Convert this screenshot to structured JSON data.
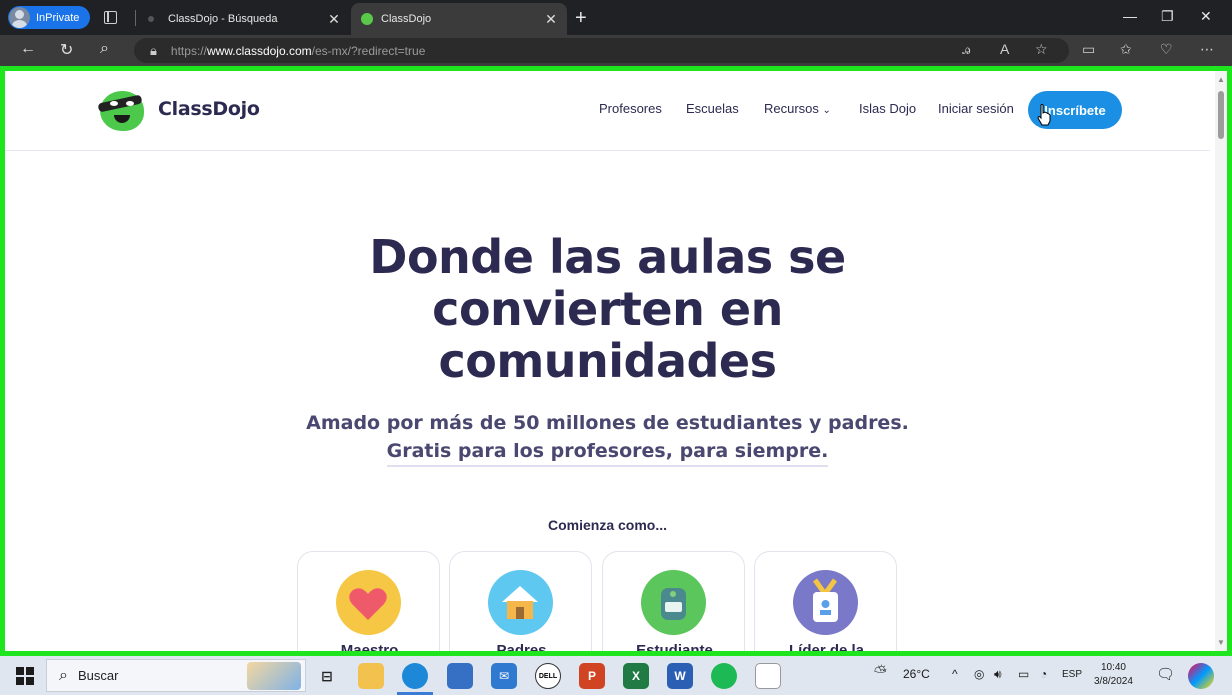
{
  "browser": {
    "inprivate_label": "InPrivate",
    "tabs": [
      {
        "title": "ClassDojo - Búsqueda"
      },
      {
        "title": "ClassDojo"
      }
    ],
    "url_scheme": "https://",
    "url_host": "www.classdojo.com",
    "url_path": "/es-mx/?redirect=true"
  },
  "site": {
    "brand": "ClassDojo",
    "nav": [
      {
        "label": "Profesores"
      },
      {
        "label": "Escuelas"
      },
      {
        "label": "Recursos"
      },
      {
        "label": "Islas Dojo"
      },
      {
        "label": "Iniciar sesión"
      }
    ],
    "signup_label": "Inscríbete",
    "hero_line1": "Donde las aulas se",
    "hero_line2": "convierten en",
    "hero_line3": "comunidades",
    "sub1": "Amado por más de 50 millones de estudiantes y padres.",
    "sub2": "Gratis para los profesores, para siempre.",
    "start_as": "Comienza como...",
    "roles": [
      {
        "label": "Maestro"
      },
      {
        "label": "Padres"
      },
      {
        "label": "Estudiante"
      },
      {
        "label": "Líder de la"
      }
    ]
  },
  "taskbar": {
    "search_placeholder": "Buscar",
    "weather": "26°C",
    "lang": "ESP",
    "time": "10:40",
    "date": "3/8/2024"
  },
  "colors": {
    "accent": "#1a8fe3",
    "brand_text": "#2c2a50",
    "highlight_border": "#1ee51e"
  }
}
